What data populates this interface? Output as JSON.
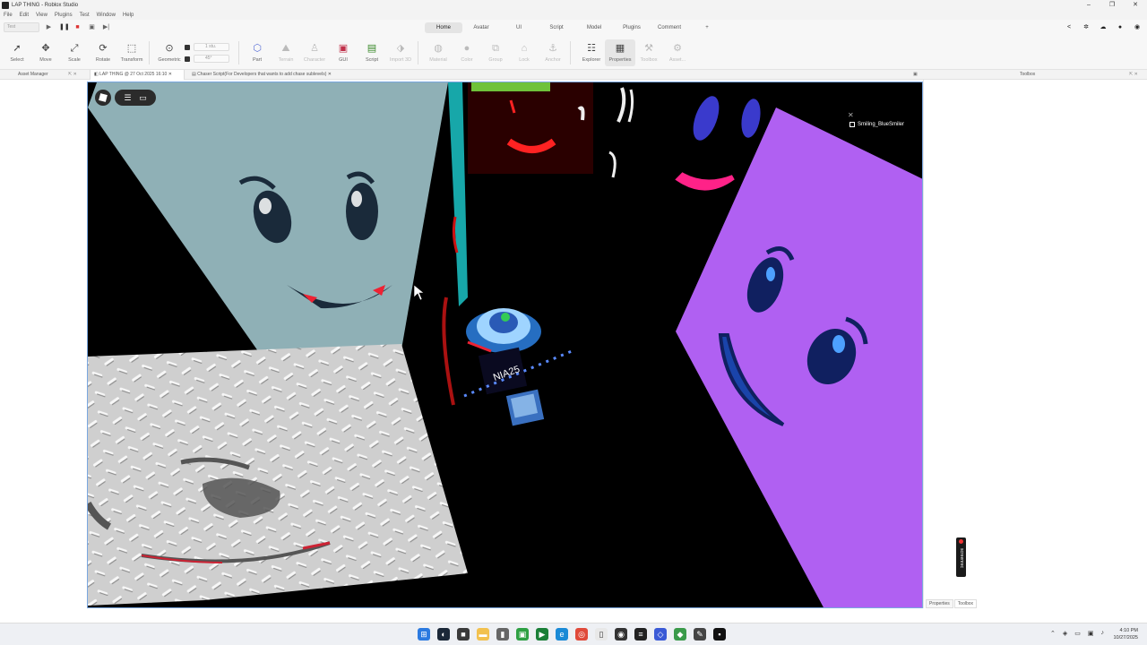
{
  "window": {
    "title": "LAP THING - Roblox Studio",
    "controls": [
      "–",
      "❐",
      "✕"
    ]
  },
  "menu": [
    "File",
    "Edit",
    "View",
    "Plugins",
    "Test",
    "Window",
    "Help"
  ],
  "run_controls": {
    "select_value": "Test",
    "icons": [
      "▶",
      "❚❚",
      "■",
      "▣",
      "▶|"
    ]
  },
  "ribbon_tabs": [
    "Home",
    "Avatar",
    "UI",
    "Script",
    "Model",
    "Plugins",
    "Comment",
    "+"
  ],
  "active_tab": "Home",
  "toolbar": {
    "tools": [
      {
        "label": "Select",
        "icon": "cursor-icon"
      },
      {
        "label": "Move",
        "icon": "move-icon"
      },
      {
        "label": "Scale",
        "icon": "scale-icon"
      },
      {
        "label": "Rotate",
        "icon": "rotate-icon"
      },
      {
        "label": "Transform",
        "icon": "transform-icon"
      },
      {
        "label": "Geometric",
        "icon": "geometric-icon"
      },
      {
        "label": "Part",
        "icon": "part-icon"
      },
      {
        "label": "Terrain",
        "icon": "terrain-icon"
      },
      {
        "label": "Character",
        "icon": "character-icon"
      },
      {
        "label": "GUI",
        "icon": "gui-icon"
      },
      {
        "label": "Script",
        "icon": "script-icon"
      },
      {
        "label": "Import 3D",
        "icon": "import-icon"
      },
      {
        "label": "Material",
        "icon": "material-icon"
      },
      {
        "label": "Color",
        "icon": "color-icon"
      },
      {
        "label": "Group",
        "icon": "group-icon"
      },
      {
        "label": "Lock",
        "icon": "lock-icon"
      },
      {
        "label": "Anchor",
        "icon": "anchor-icon"
      },
      {
        "label": "Explorer",
        "icon": "explorer-icon"
      },
      {
        "label": "Properties",
        "icon": "properties-icon"
      },
      {
        "label": "Toolbox",
        "icon": "toolbox-icon"
      },
      {
        "label": "Asset...",
        "icon": "asset-icon"
      }
    ],
    "move_step": "1 stu.",
    "rotate_step": "45°"
  },
  "panels": {
    "asset_manager": "Asset Manager",
    "toolbox": "Toolbox",
    "bottom_tabs": [
      "Properties",
      "Toolbox"
    ]
  },
  "doc_tabs": [
    {
      "label": "LAP THING @ 27 Oct 2025 16:10",
      "active": true
    },
    {
      "label": "Chaser Script(For Developers that wants to add chase sublevels)",
      "active": false
    }
  ],
  "viewport": {
    "player_name": "Smiling_BlueSmiler",
    "character_text": "NIA25",
    "recorder_label": "screenrec"
  },
  "taskbar": {
    "time": "4:10 PM",
    "date": "10/27/2025"
  },
  "colors": {
    "accent": "#2b6fd6",
    "light_blue_wall": "#8fb0b6",
    "purple_wall": "#b060f2",
    "floor_plate": "#cfcfcf"
  }
}
